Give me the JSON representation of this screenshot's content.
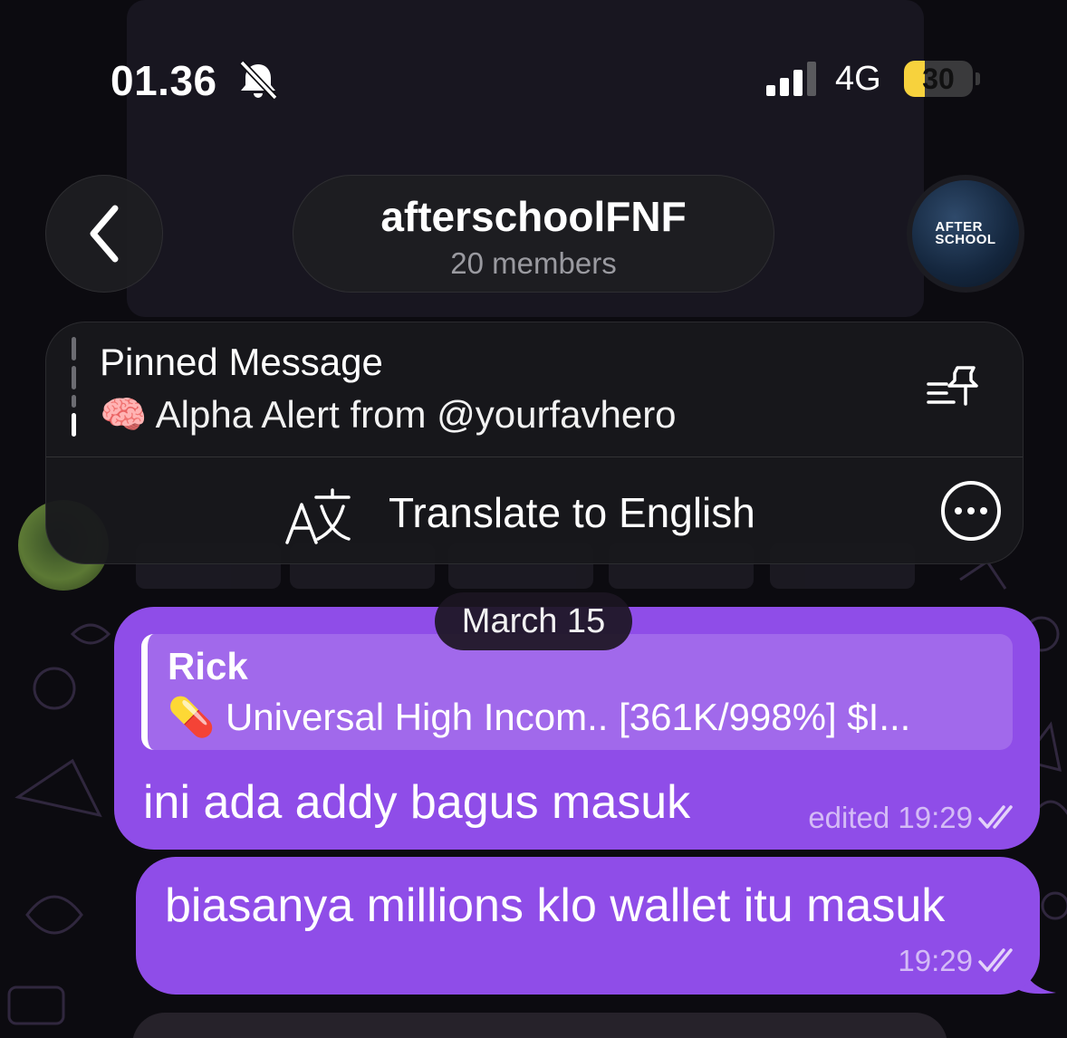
{
  "status_bar": {
    "time": "01.36",
    "network": "4G",
    "battery": "30",
    "battery_level": 0.3,
    "icons": [
      "bell-slash-icon",
      "signal-icon",
      "battery-icon"
    ]
  },
  "header": {
    "title": "afterschoolFNF",
    "subtitle": "20 members",
    "avatar_logo_line1": "AFTER",
    "avatar_logo_line2": "SCHOOL",
    "icons": [
      "chevron-left-icon"
    ]
  },
  "pinned": {
    "label": "Pinned Message",
    "text": "🧠 Alpha Alert from @yourfavhero",
    "icons": [
      "pin-list-icon"
    ]
  },
  "translate": {
    "label": "Translate to English",
    "icons": [
      "translate-icon",
      "more-icon"
    ]
  },
  "chat": {
    "date": "March 15",
    "messages": [
      {
        "reply_name": "Rick",
        "reply_text": "💊 Universal High Incom.. [361K/998%] $I...",
        "text": "ini ada addy bagus masuk",
        "meta": "edited 19:29"
      },
      {
        "text": "biasanya millions klo wallet itu masuk",
        "meta": "19:29"
      }
    ]
  },
  "colors": {
    "bubble": "#8f4de8",
    "background": "#0c0b10",
    "battery_accent": "#f7d23d"
  }
}
